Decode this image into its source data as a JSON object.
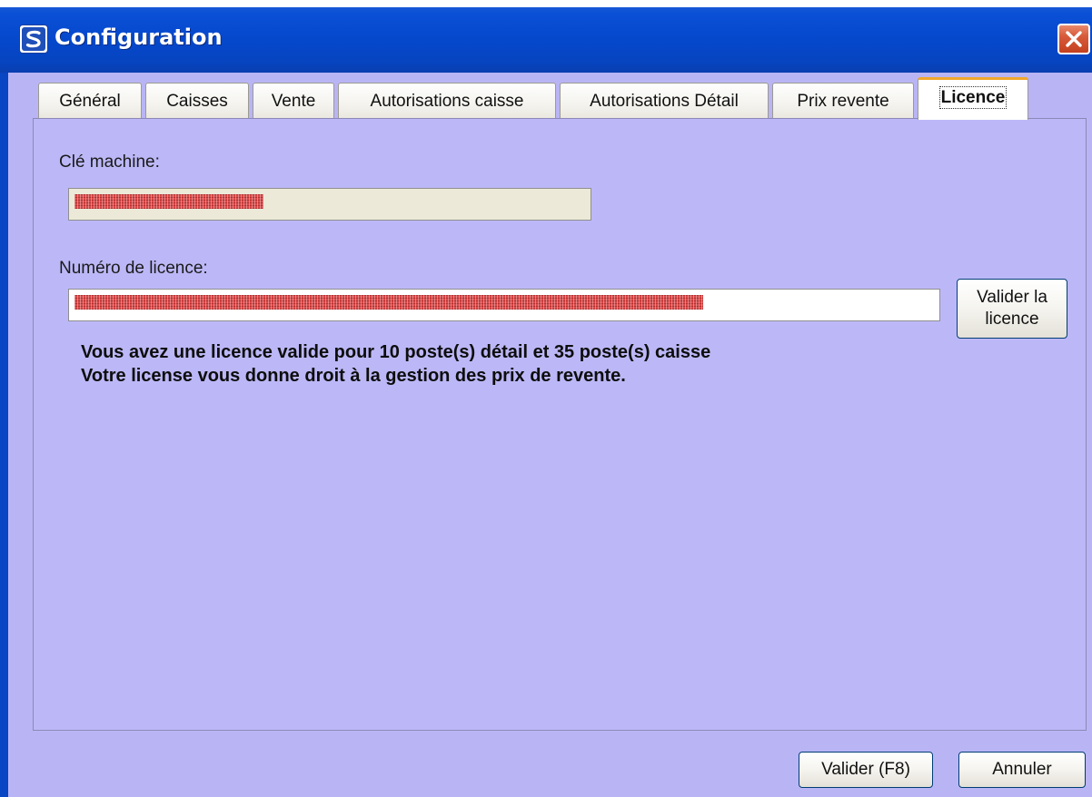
{
  "window": {
    "title": "Configuration",
    "app_icon_letter": "S"
  },
  "tabs": [
    {
      "label": "Général",
      "active": false
    },
    {
      "label": "Caisses",
      "active": false
    },
    {
      "label": "Vente",
      "active": false
    },
    {
      "label": "Autorisations caisse",
      "active": false
    },
    {
      "label": "Autorisations Détail",
      "active": false
    },
    {
      "label": "Prix revente",
      "active": false
    },
    {
      "label": "Licence",
      "active": true
    }
  ],
  "licence": {
    "machine_key_label": "Clé machine:",
    "licence_number_label": "Numéro de licence:",
    "validate_licence_button": "Valider la\nlicence",
    "validate_licence_line1": "Valider la",
    "validate_licence_line2": "licence",
    "message_line1": "Vous avez une licence valide pour 10 poste(s) détail et 35 poste(s) caisse",
    "message_line2": "Votre license vous donne droit à la gestion des prix de revente."
  },
  "footer": {
    "ok_button": "Valider (F8)",
    "cancel_button": "Annuler"
  },
  "colors": {
    "panel_background": "#bcb8f7",
    "title_bar": "#0548cc",
    "active_tab_accent": "#f0a72a",
    "masked_value": "#d94a4a"
  }
}
